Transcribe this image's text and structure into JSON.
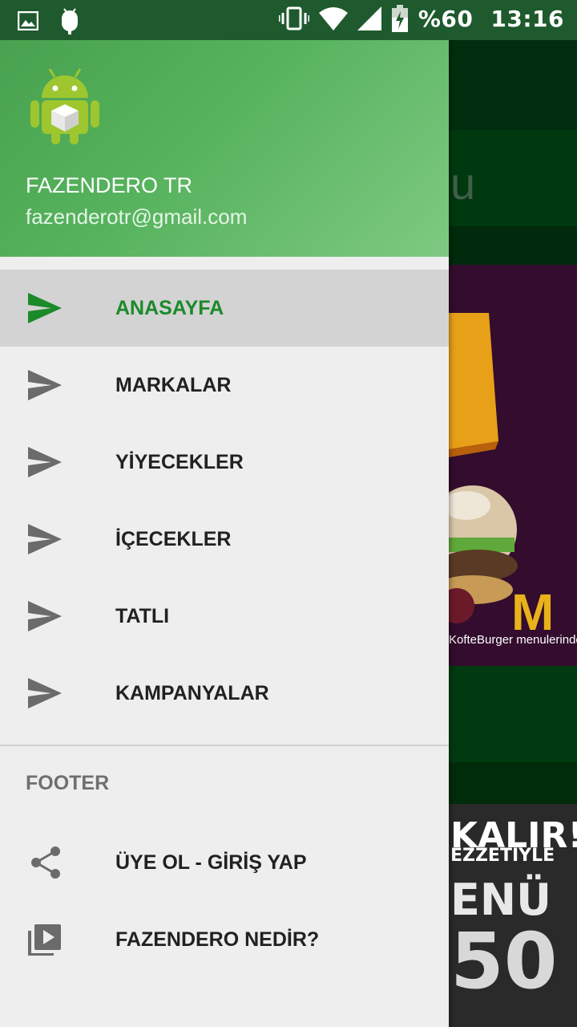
{
  "status_bar": {
    "battery": "%60",
    "time": "13:16"
  },
  "drawer": {
    "header": {
      "name": "FAZENDERO TR",
      "email": "fazenderotr@gmail.com"
    },
    "menu": [
      {
        "label": "ANASAYFA",
        "icon": "send-icon",
        "active": true
      },
      {
        "label": "MARKALAR",
        "icon": "send-icon",
        "active": false
      },
      {
        "label": "YİYECEKLER",
        "icon": "send-icon",
        "active": false
      },
      {
        "label": "İÇECEKLER",
        "icon": "send-icon",
        "active": false
      },
      {
        "label": "TATLI",
        "icon": "send-icon",
        "active": false
      },
      {
        "label": "KAMPANYALAR",
        "icon": "send-icon",
        "active": false
      }
    ],
    "footer_heading": "FOOTER",
    "footer": [
      {
        "label": "ÜYE OL - GİRİŞ YAP",
        "icon": "share-icon"
      },
      {
        "label": "FAZENDERO NEDİR?",
        "icon": "video-library-icon"
      }
    ]
  },
  "background": {
    "partial_title": "u",
    "ad1_caption": "KofteBurger menulerinde",
    "ad2_lines": [
      "KALIR!",
      "EZZETİYLE",
      "ENÜ",
      "50"
    ]
  },
  "colors": {
    "accent": "#1b8a2a",
    "header_start": "#48a24f",
    "header_end": "#7ec982",
    "active_bg": "#d3d3d3",
    "drawer_bg": "#eeeeee"
  }
}
